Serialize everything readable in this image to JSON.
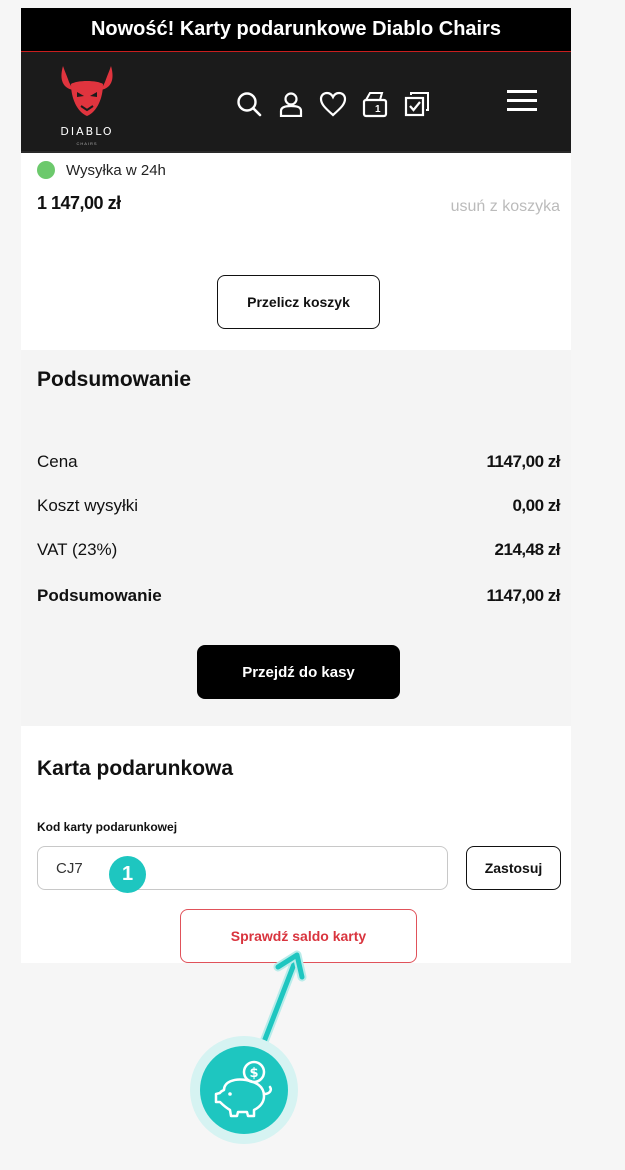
{
  "promo": {
    "text": "Nowość! Karty podarunkowe Diablo Chairs"
  },
  "brand": {
    "name": "DIABLO",
    "sub": "CHAIRS",
    "accent": "#e0343e"
  },
  "nav": {
    "icons": [
      "search-icon",
      "account-icon",
      "heart-icon",
      "cart-icon",
      "compare-icon",
      "menu-icon"
    ],
    "cart_count": "1"
  },
  "cart_item": {
    "shipping": "Wysyłka w 24h",
    "price": "1 147,00 zł",
    "remove": "usuń z koszyka"
  },
  "recalc_label": "Przelicz koszyk",
  "summary": {
    "title": "Podsumowanie",
    "rows": [
      {
        "label": "Cena",
        "value": "1147,00 zł"
      },
      {
        "label": "Koszt wysyłki",
        "value": "0,00 zł"
      },
      {
        "label": "VAT (23%)",
        "value": "214,48 zł"
      },
      {
        "label": "Podsumowanie",
        "value": "1147,00 zł"
      }
    ],
    "checkout_label": "Przejdź do kasy"
  },
  "gift": {
    "title": "Karta podarunkowa",
    "code_label": "Kod karty podarunkowej",
    "code_value": "CJ7",
    "apply_label": "Zastosuj",
    "check_balance_label": "Sprawdź saldo karty"
  },
  "annotation": {
    "step": "1",
    "color": "#1ec6c0"
  }
}
